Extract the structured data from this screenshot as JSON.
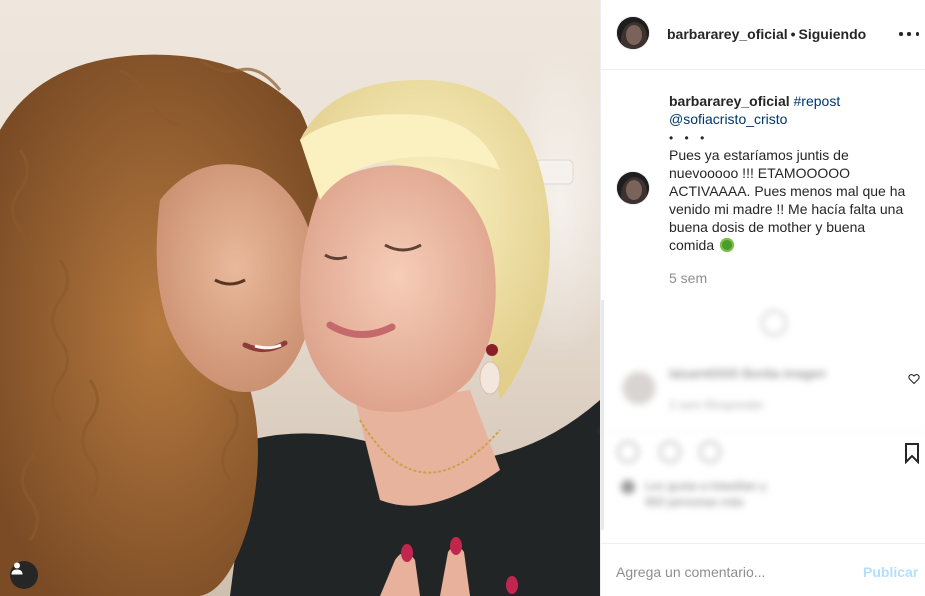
{
  "post": {
    "username": "barbararey_oficial",
    "separator": "•",
    "follow_status": "Siguiendo"
  },
  "caption": {
    "username": "barbararey_oficial",
    "hashtag": "#repost",
    "mention": "@sofiacristo_cristo",
    "dots": "• • •",
    "text": "Pues ya estaríamos juntis de nuevooooo !!! ETAMOOOOO ACTIVAAAA. Pues menos mal que ha venido mi madre !! Me hacía falta una buena dosis de mother y buena comida",
    "time_ago": "5 sem"
  },
  "blurred_comment": {
    "text": "laisamt0000 Bonita imagen",
    "meta": "2 sem     Responder"
  },
  "likes": {
    "line1": "Les gusta a lolastilan y",
    "line2": "950 personas más"
  },
  "comment_box": {
    "placeholder": "Agrega un comentario...",
    "publish_label": "Publicar"
  },
  "icons": {
    "more": "more-options-icon",
    "tag": "user-tag-icon",
    "bookmark": "bookmark-icon",
    "heart": "heart-icon"
  },
  "colors": {
    "link": "#003569",
    "publish_disabled": "#b2dffc",
    "muted": "#8e8e8e"
  }
}
